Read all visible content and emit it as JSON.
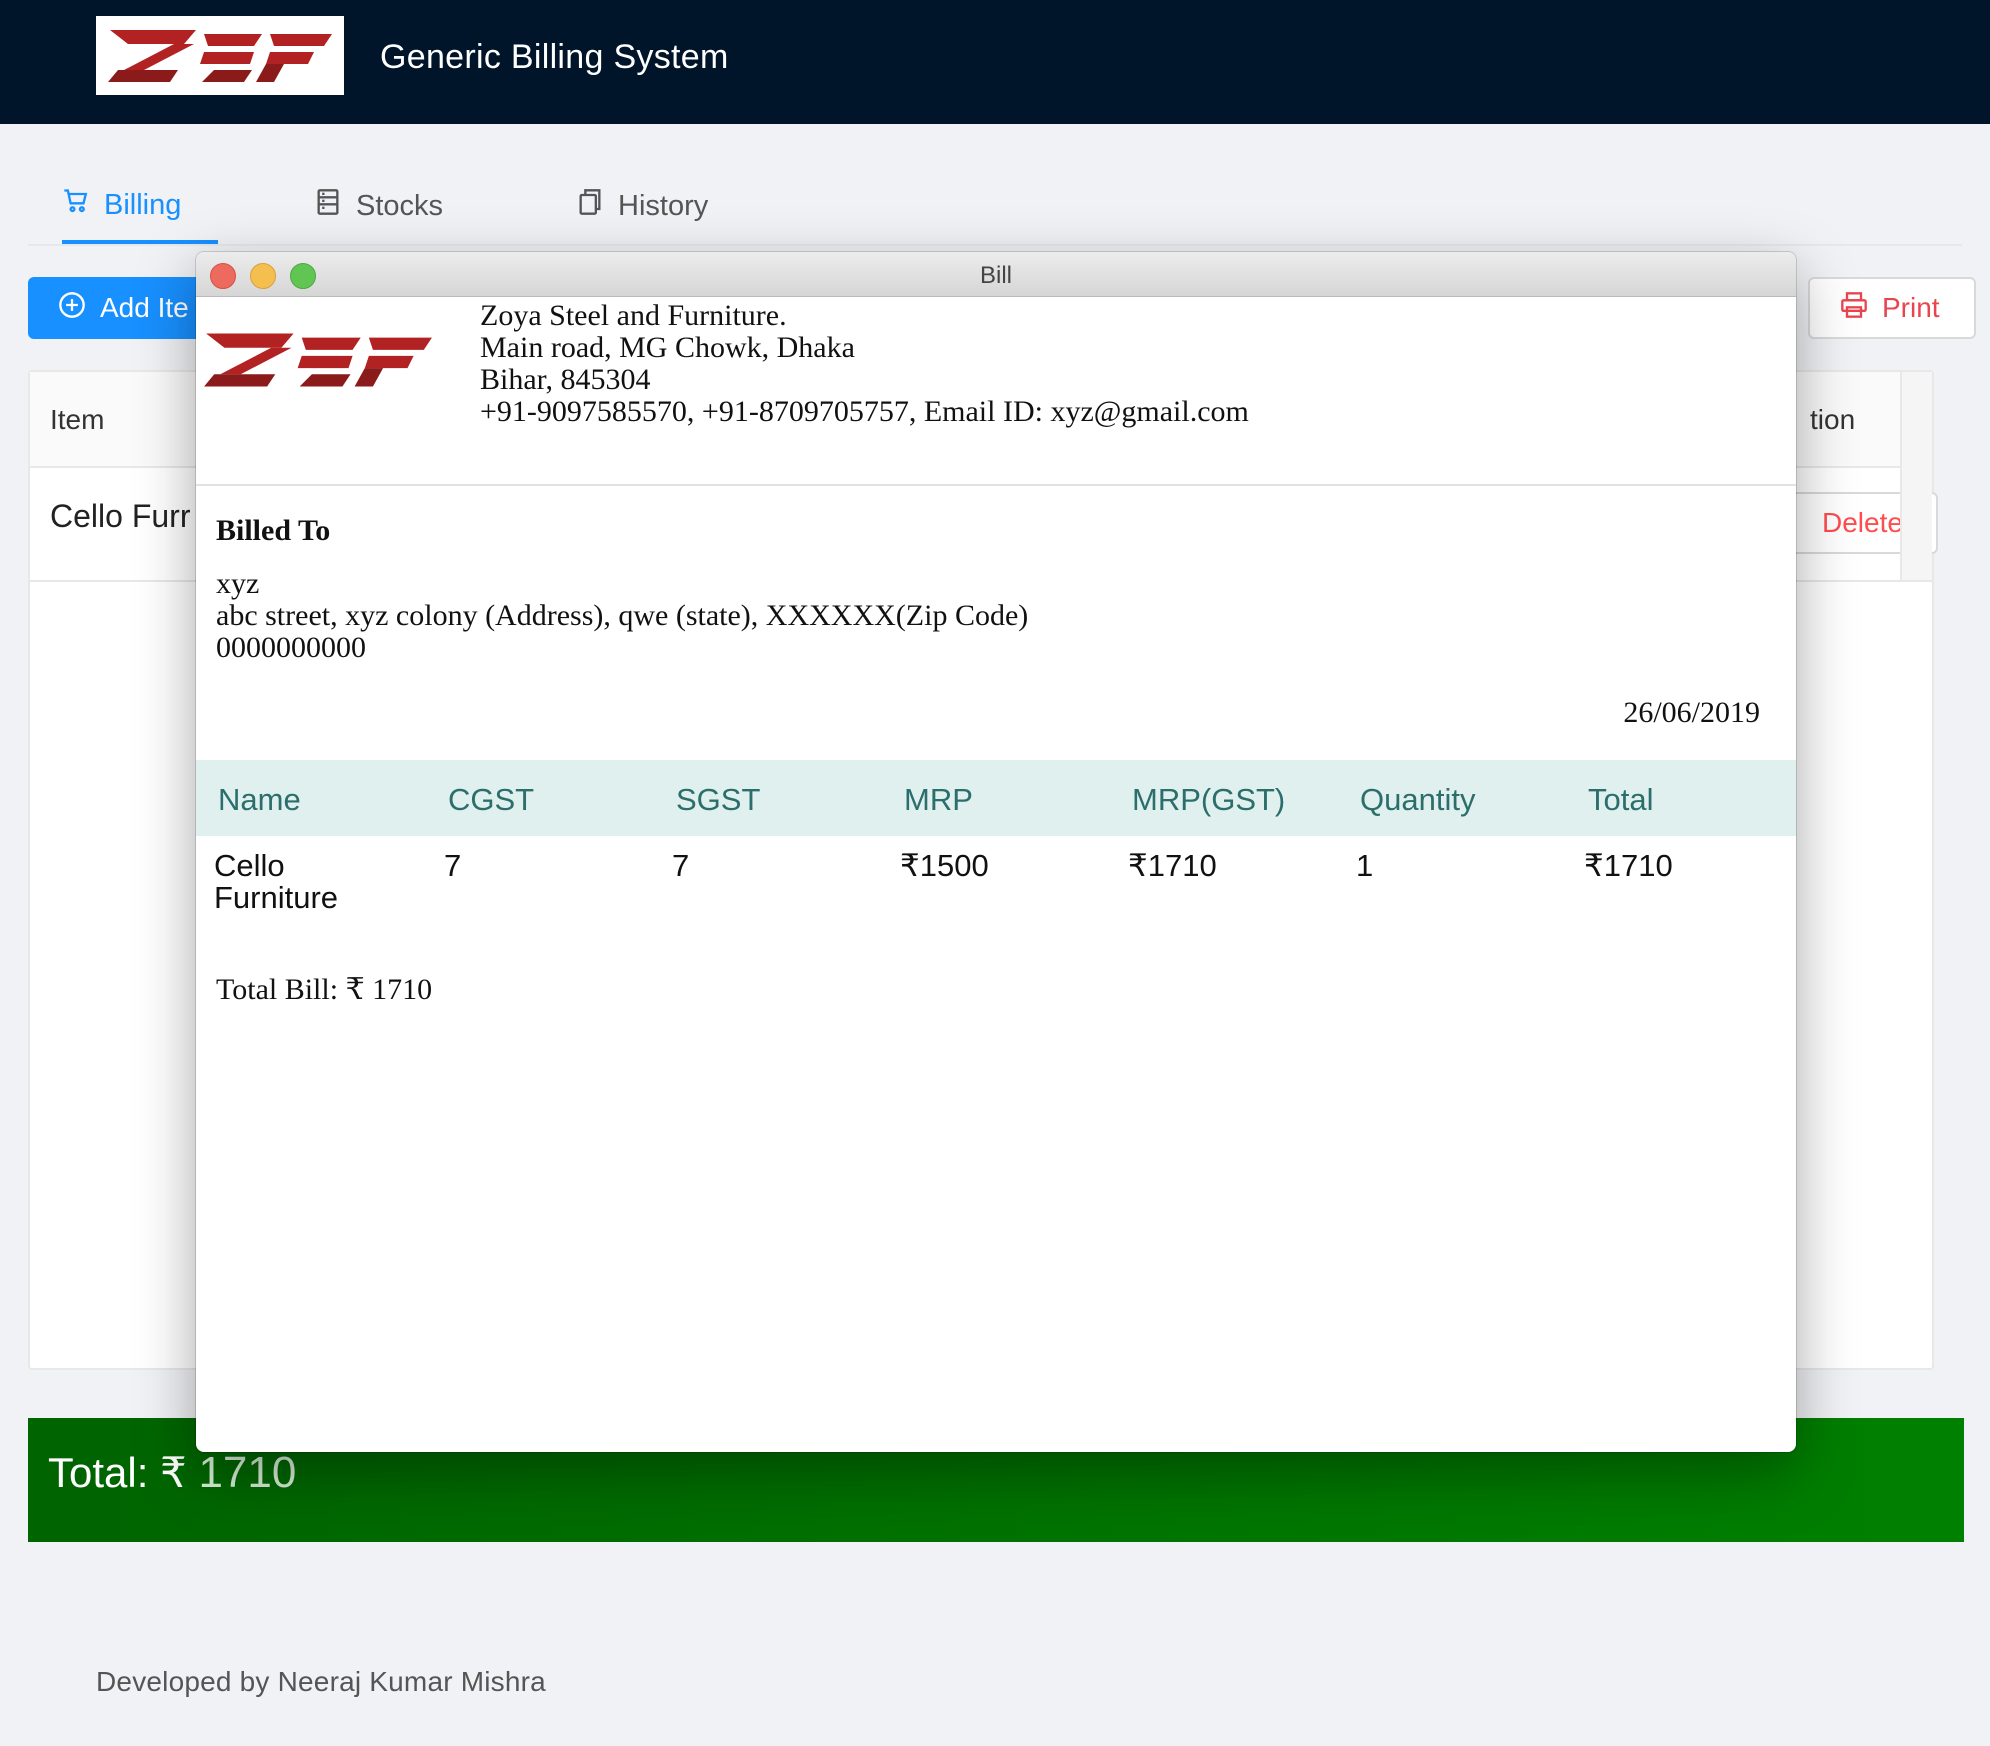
{
  "app": {
    "title": "Generic Billing System",
    "logo_text": "ZSF",
    "brand_color": "#b22222"
  },
  "tabs": [
    {
      "label": "Billing",
      "icon": "shopping-cart-icon",
      "active": true
    },
    {
      "label": "Stocks",
      "icon": "database-icon",
      "active": false
    },
    {
      "label": "History",
      "icon": "copy-icon",
      "active": false
    }
  ],
  "toolbar": {
    "add_label": "Add Ite",
    "print_label": "Print"
  },
  "items_table": {
    "col_item": "Item",
    "col_action": "tion",
    "row_item": "Cello Furr",
    "delete_label": "Delete"
  },
  "total_bar": {
    "label": "Total: ₹",
    "value": "1710"
  },
  "footer": "Developed by Neeraj Kumar Mishra",
  "bill": {
    "window_title": "Bill",
    "company": {
      "name": "Zoya Steel and Furniture.",
      "address1": "Main road, MG Chowk, Dhaka",
      "address2": "Bihar, 845304",
      "contact": "+91-9097585570, +91-8709705757, Email ID: xyz@gmail.com"
    },
    "billed_to_title": "Billed To",
    "customer": {
      "name": "xyz",
      "address": "abc street, xyz colony (Address), qwe (state), XXXXXX(Zip Code)",
      "phone": "0000000000"
    },
    "date": "26/06/2019",
    "columns": [
      "Name",
      "CGST",
      "SGST",
      "MRP",
      "MRP(GST)",
      "Quantity",
      "Total"
    ],
    "rows": [
      {
        "name_line1": "Cello",
        "name_line2": "Furniture",
        "cgst": "7",
        "sgst": "7",
        "mrp": "₹1500",
        "mrp_gst": "₹1710",
        "quantity": "1",
        "total": "₹1710"
      }
    ],
    "total_bill": "Total Bill: ₹ 1710"
  }
}
